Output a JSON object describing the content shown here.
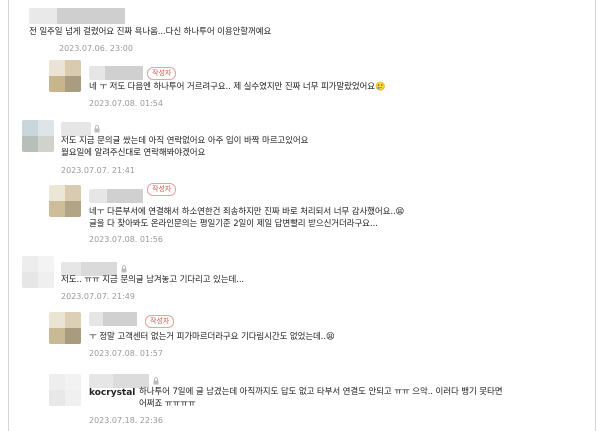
{
  "writer_badge": "작성자",
  "comments": [
    {
      "text": "전 일주일 넘게 걸렸어요 진짜 욕나옴...다신 하나투어 이용안할꺼예요",
      "date": "2023.07.06. 23:00"
    },
    {
      "text": "네 ㅜ 저도 다음엔 하나투어 거르려구요.. 제 실수였지만 진짜 너무 피가말랐었어요🥲",
      "date": "2023.07.08. 01:54"
    },
    {
      "text": "저도 지금 문의글 쌌는데 아직 연락없어요 아주 입이 바짝 마르고있어요\n월요일에 알려주신대로 연락해봐야겠어요",
      "date": "2023.07.07. 21:41"
    },
    {
      "text": "네ㅜ 다른부서에 연결해서 하소연한건 죄송하지만 진짜 바로 처리되서 너무 감사했어요..😫\n글을 다 찾아봐도 온라인문의는 평일기준 2일이 제일 답변빨리 받으신거더라구요...",
      "date": "2023.07.08. 01:56"
    },
    {
      "text": "저도.. ㅠㅠ 지금 문의글 남겨놓고 기다리고 있는데...",
      "date": "2023.07.07. 21:49"
    },
    {
      "text": "ㅜ 정말 고객센터 없는거 피가마르더라구요 기다림시간도 없었는데..😫",
      "date": "2023.07.08. 01:57"
    },
    {
      "author": "kocrystal",
      "text": "하나투어 7일에 글 남겼는데 아직까지도 답도 없고 타부서 연결도 안되고 ㅠㅠ 으악.. 이러다 뱅기 못타면\n어쩌죠 ㅠㅠㅠㅠ",
      "date": "2023.07.18. 22:36"
    }
  ]
}
